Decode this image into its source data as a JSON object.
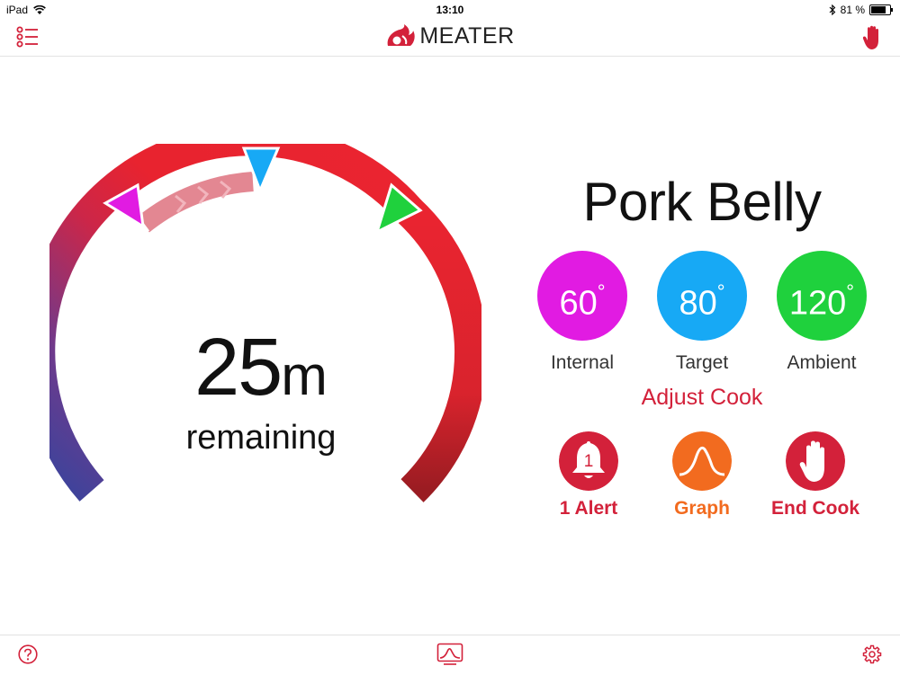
{
  "status_bar": {
    "device": "iPad",
    "time": "13:10",
    "battery": "81 %",
    "battery_level": 0.81,
    "icons": [
      "wifi-icon",
      "bluetooth-icon",
      "battery-icon"
    ]
  },
  "nav": {
    "brand": "MEATER",
    "left_icon": "list-icon",
    "right_icon": "hand-icon"
  },
  "gauge": {
    "time_value": "25",
    "time_unit": "m",
    "remaining_label": "remaining",
    "markers": [
      "internal-marker",
      "target-marker",
      "ambient-marker"
    ]
  },
  "cook": {
    "name": "Pork Belly",
    "temps": [
      {
        "id": "internal",
        "value": "60",
        "degree": "°",
        "label": "Internal",
        "color": "#e11be2"
      },
      {
        "id": "target",
        "value": "80",
        "degree": "°",
        "label": "Target",
        "color": "#17a9f5"
      },
      {
        "id": "ambient",
        "value": "120",
        "degree": "°",
        "label": "Ambient",
        "color": "#1fd13d"
      }
    ],
    "adjust_label": "Adjust Cook"
  },
  "actions": [
    {
      "id": "alert",
      "label": "1 Alert",
      "icon": "bell-icon",
      "badge": "1",
      "color": "#d3213a"
    },
    {
      "id": "graph",
      "label": "Graph",
      "icon": "graph-icon",
      "color": "#f26b1f"
    },
    {
      "id": "end",
      "label": "End Cook",
      "icon": "hand-icon",
      "color": "#d3213a"
    }
  ],
  "bottom_bar": {
    "icons": [
      "help-icon",
      "graph-icon",
      "gear-icon"
    ]
  },
  "colors": {
    "brand_red": "#d3213a",
    "divider": "#e2e2e2"
  }
}
